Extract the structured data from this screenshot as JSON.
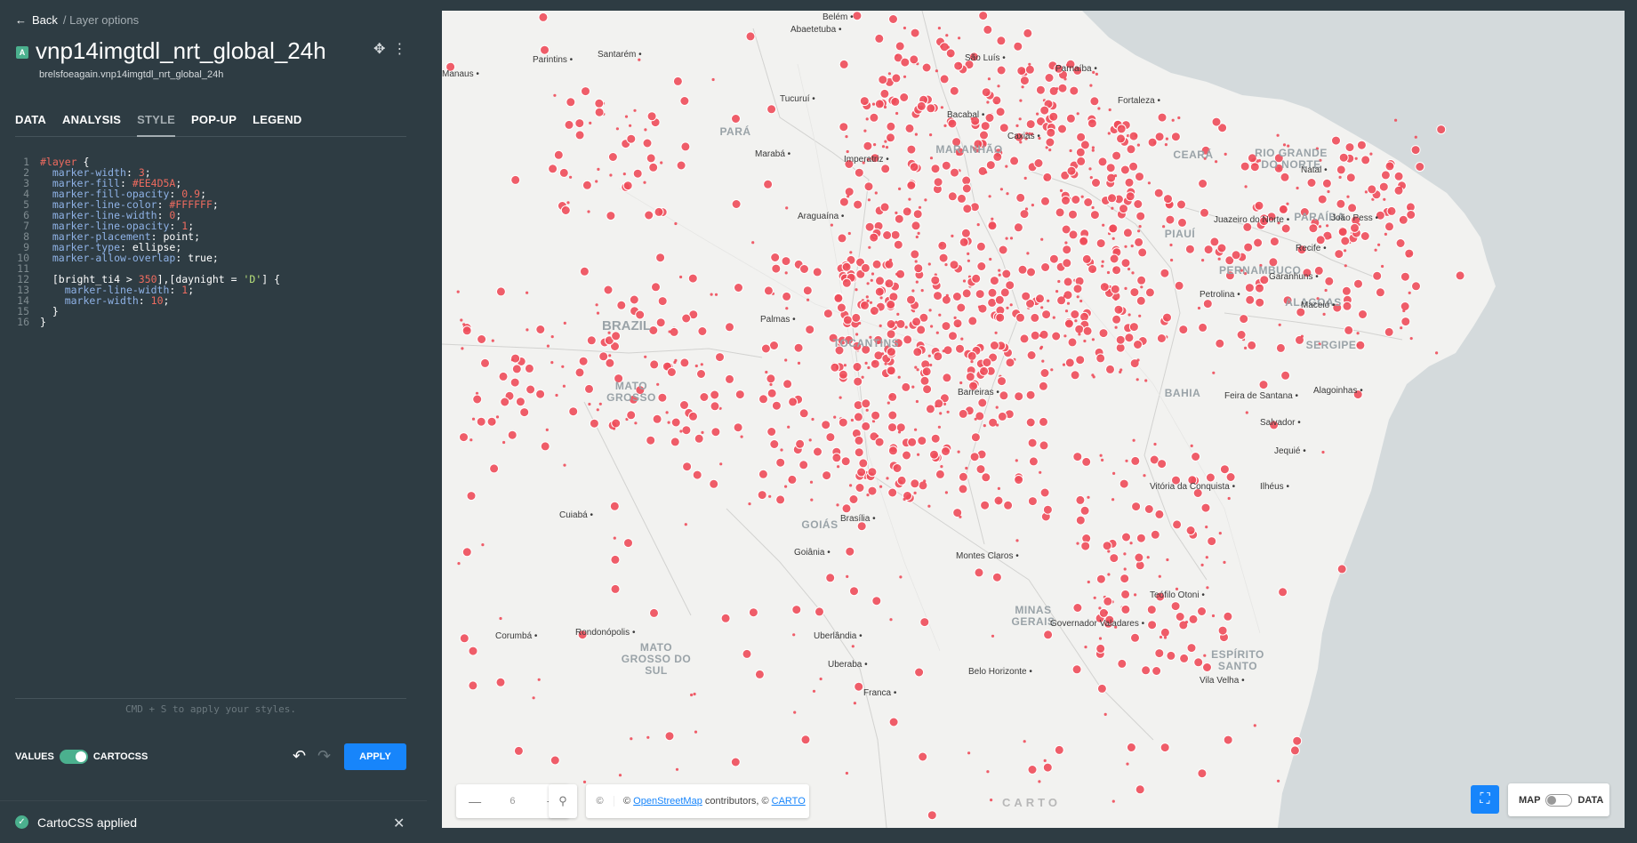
{
  "header": {
    "back_label": "Back",
    "breadcrumb": "/ Layer options",
    "layer_letter": "A",
    "layer_title": "vnp14imgtdl_nrt_global_24h",
    "layer_source": "brelsfoeagain.vnp14imgtdl_nrt_global_24h"
  },
  "tabs": [
    {
      "label": "DATA"
    },
    {
      "label": "ANALYSIS"
    },
    {
      "label": "STYLE",
      "active": true
    },
    {
      "label": "POP-UP"
    },
    {
      "label": "LEGEND"
    }
  ],
  "editor": {
    "lines": [
      "#layer {",
      "  marker-width: 3;",
      "  marker-fill: #EE4D5A;",
      "  marker-fill-opacity: 0.9;",
      "  marker-line-color: #FFFFFF;",
      "  marker-line-width: 0;",
      "  marker-line-opacity: 1;",
      "  marker-placement: point;",
      "  marker-type: ellipse;",
      "  marker-allow-overlap: true;",
      "",
      "  [bright_ti4 > 350],[daynight = 'D'] {",
      "    marker-line-width: 1;",
      "    marker-width: 10;",
      "  }",
      "}"
    ],
    "hint": "CMD + S to apply your styles."
  },
  "footer": {
    "values_label": "VALUES",
    "cartocss_label": "CARTOCSS",
    "apply_label": "APPLY"
  },
  "toast": {
    "message": "CartoCSS applied"
  },
  "map": {
    "marker_color": "#EE4D5A",
    "ocean_color": "#d4dadc",
    "land_color": "#f2f2f0",
    "zoom_level": "6",
    "attribution_prefix": "©",
    "attribution_osm": "OpenStreetMap",
    "attribution_mid": "contributors, ©",
    "attribution_carto": "CARTO",
    "logo": "CARTO",
    "toggle_map": "MAP",
    "toggle_data": "DATA",
    "labels": [
      {
        "name": "Belém",
        "type": "city"
      },
      {
        "name": "Abaetetuba",
        "type": "city"
      },
      {
        "name": "Santarém",
        "type": "city"
      },
      {
        "name": "Parintins",
        "type": "city"
      },
      {
        "name": "São Luís",
        "type": "city"
      },
      {
        "name": "Parnaíba",
        "type": "city"
      },
      {
        "name": "Fortaleza",
        "type": "city"
      },
      {
        "name": "Tucuruí",
        "type": "city"
      },
      {
        "name": "Bacabal",
        "type": "city"
      },
      {
        "name": "Caxias",
        "type": "city"
      },
      {
        "name": "PARÁ",
        "type": "region"
      },
      {
        "name": "MARANHÃO",
        "type": "region"
      },
      {
        "name": "CEARÁ",
        "type": "region"
      },
      {
        "name": "RIO GRANDE DO NORTE",
        "type": "region"
      },
      {
        "name": "Natal",
        "type": "city"
      },
      {
        "name": "Marabá",
        "type": "city"
      },
      {
        "name": "Imperatriz",
        "type": "city"
      },
      {
        "name": "Araguaína",
        "type": "city"
      },
      {
        "name": "PIAUÍ",
        "type": "region"
      },
      {
        "name": "Juazeiro do Norte",
        "type": "city"
      },
      {
        "name": "PARAÍBA",
        "type": "region"
      },
      {
        "name": "João Pess",
        "type": "city"
      },
      {
        "name": "Recife",
        "type": "city"
      },
      {
        "name": "PERNAMBUCO",
        "type": "region"
      },
      {
        "name": "Garanhuns",
        "type": "city"
      },
      {
        "name": "Petrolina",
        "type": "city"
      },
      {
        "name": "ALAGOAS",
        "type": "region"
      },
      {
        "name": "Maceió",
        "type": "city"
      },
      {
        "name": "Palmas",
        "type": "city"
      },
      {
        "name": "BRAZIL",
        "type": "country"
      },
      {
        "name": "TOCANTINS",
        "type": "region"
      },
      {
        "name": "SERGIPE",
        "type": "region"
      },
      {
        "name": "MATO GROSSO",
        "type": "region"
      },
      {
        "name": "Barreiras",
        "type": "city"
      },
      {
        "name": "BAHIA",
        "type": "region"
      },
      {
        "name": "Feira de Santana",
        "type": "city"
      },
      {
        "name": "Alagoinhas",
        "type": "city"
      },
      {
        "name": "Salvador",
        "type": "city"
      },
      {
        "name": "Jequié",
        "type": "city"
      },
      {
        "name": "Vitória da Conquista",
        "type": "city"
      },
      {
        "name": "Ilhéus",
        "type": "city"
      },
      {
        "name": "Cuiabá",
        "type": "city"
      },
      {
        "name": "Brasília",
        "type": "city"
      },
      {
        "name": "GOIÁS",
        "type": "region"
      },
      {
        "name": "Goiânia",
        "type": "city"
      },
      {
        "name": "Montes Claros",
        "type": "city"
      },
      {
        "name": "Teófilo Otoni",
        "type": "city"
      },
      {
        "name": "MINAS GERAIS",
        "type": "region"
      },
      {
        "name": "Governador Valadares",
        "type": "city"
      },
      {
        "name": "Rondonópolis",
        "type": "city"
      },
      {
        "name": "Uberlândia",
        "type": "city"
      },
      {
        "name": "Corumbá",
        "type": "city"
      },
      {
        "name": "MATO GROSSO DO SUL",
        "type": "region"
      },
      {
        "name": "Uberaba",
        "type": "city"
      },
      {
        "name": "Belo Horizonte",
        "type": "city"
      },
      {
        "name": "ESPÍRITO SANTO",
        "type": "region"
      },
      {
        "name": "Vila Velha",
        "type": "city"
      },
      {
        "name": "Franca",
        "type": "city"
      },
      {
        "name": "Manaus",
        "type": "city"
      }
    ]
  }
}
